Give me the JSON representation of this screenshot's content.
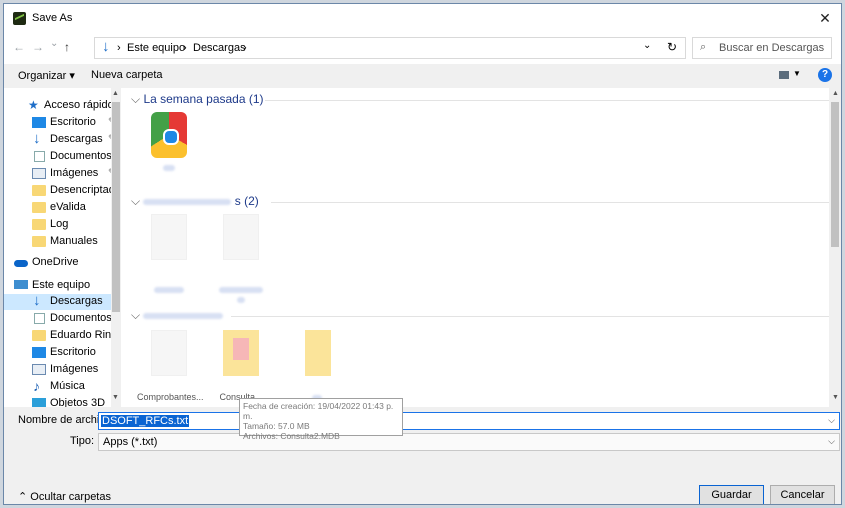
{
  "window": {
    "title": "Save As",
    "close_glyph": "✕"
  },
  "nav_buttons": {
    "back": "←",
    "forward": "→",
    "recent": "⌄",
    "up": "↑"
  },
  "address": {
    "crumbs": [
      "Este equipo",
      "Descargas"
    ],
    "separator": "›",
    "dropdown": "⌄",
    "refresh": "↻"
  },
  "search": {
    "placeholder": "Buscar en Descargas",
    "icon": "search-icon"
  },
  "toolbar": {
    "organize": "Organizar ▾",
    "new_folder": "Nueva carpeta",
    "help": "?"
  },
  "nav": {
    "items": [
      {
        "label": "Acceso rápido",
        "icon": "star-icon"
      },
      {
        "label": "Escritorio",
        "icon": "desktop-icon",
        "pinned": true
      },
      {
        "label": "Descargas",
        "icon": "downloads-icon",
        "pinned": true
      },
      {
        "label": "Documentos",
        "icon": "documents-icon",
        "pinned": true
      },
      {
        "label": "Imágenes",
        "icon": "pictures-icon",
        "pinned": true
      },
      {
        "label": "Desencriptado",
        "icon": "folder-icon"
      },
      {
        "label": "eValida",
        "icon": "folder-icon"
      },
      {
        "label": "Log",
        "icon": "folder-icon"
      },
      {
        "label": "Manuales",
        "icon": "folder-icon"
      },
      {
        "label": "OneDrive",
        "icon": "cloud-icon"
      },
      {
        "label": "Este equipo",
        "icon": "computer-icon"
      },
      {
        "label": "Descargas",
        "icon": "downloads-icon",
        "selected": true
      },
      {
        "label": "Documentos",
        "icon": "documents-icon"
      },
      {
        "label": "Eduardo Rincon",
        "icon": "folder-icon"
      },
      {
        "label": "Escritorio",
        "icon": "desktop-icon"
      },
      {
        "label": "Imágenes",
        "icon": "pictures-icon"
      },
      {
        "label": "Música",
        "icon": "music-icon"
      },
      {
        "label": "Objetos 3D",
        "icon": "3d-objects-icon"
      }
    ],
    "pin_glyph": "📌"
  },
  "groups": [
    {
      "header": "La semana pasada (1)",
      "collapse_glyph": "⌵"
    },
    {
      "header_suffix": "s (2)",
      "collapse_glyph": "⌵"
    },
    {
      "header_suffix": "",
      "collapse_glyph": "⌵"
    }
  ],
  "files_group3": {
    "captions": [
      "Comprobantes...",
      "Consulta..."
    ]
  },
  "tooltip": {
    "created": "Fecha de creación: 19/04/2022 01:43 p. m.",
    "size": "Tamaño: 57.0 MB",
    "files": "Archivos: Consulta2.MDB"
  },
  "form": {
    "filename_label": "Nombre de archivo:",
    "filename_value": "DSOFT_RFCs.txt",
    "type_label": "Tipo:",
    "type_value": "Apps (*.txt)",
    "dropdown": "⌵"
  },
  "footer": {
    "hide_folders": "Ocultar carpetas",
    "hide_glyph": "⌃",
    "save": "Guardar",
    "cancel": "Cancelar"
  }
}
